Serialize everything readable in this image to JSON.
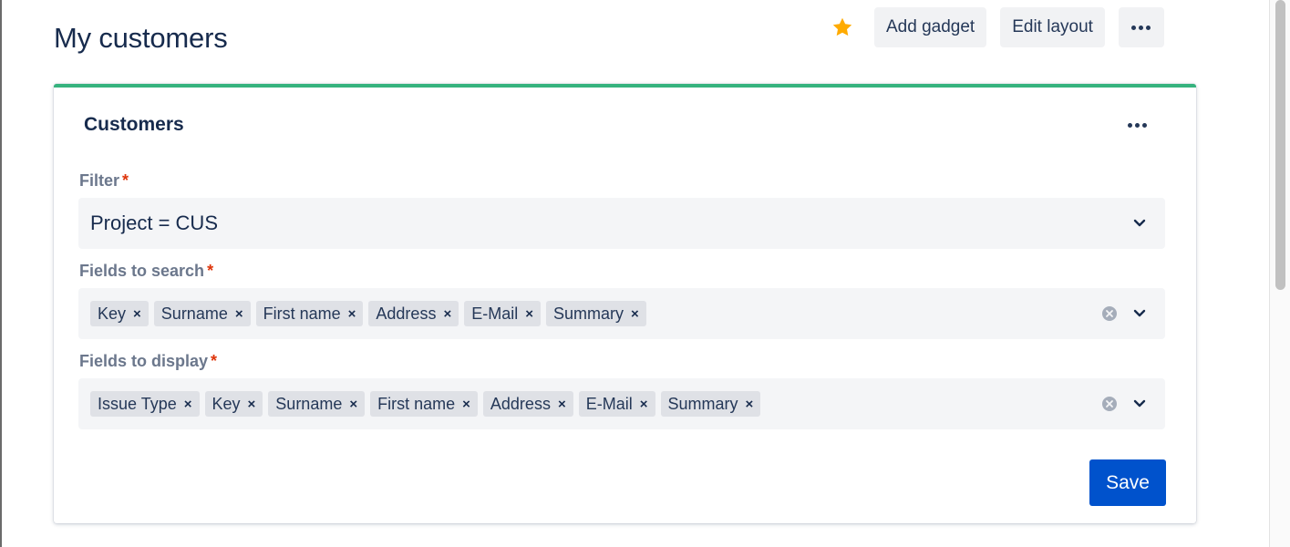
{
  "page": {
    "title": "My customers"
  },
  "toolbar": {
    "star_icon": "star-icon",
    "star_color": "#ffab00",
    "add_gadget_label": "Add gadget",
    "edit_layout_label": "Edit layout",
    "more_icon": "more-icon"
  },
  "card": {
    "title": "Customers",
    "accent_color": "#36b37e",
    "more_icon": "more-icon",
    "filter": {
      "label": "Filter",
      "required_mark": "*",
      "value": "Project = CUS"
    },
    "fields_to_search": {
      "label": "Fields to search",
      "required_mark": "*",
      "tags": [
        "Key",
        "Surname",
        "First name",
        "Address",
        "E-Mail",
        "Summary"
      ]
    },
    "fields_to_display": {
      "label": "Fields to display",
      "required_mark": "*",
      "tags": [
        "Issue Type",
        "Key",
        "Surname",
        "First name",
        "Address",
        "E-Mail",
        "Summary"
      ]
    },
    "remove_glyph": "×",
    "save_label": "Save",
    "save_color": "#0052cc"
  }
}
